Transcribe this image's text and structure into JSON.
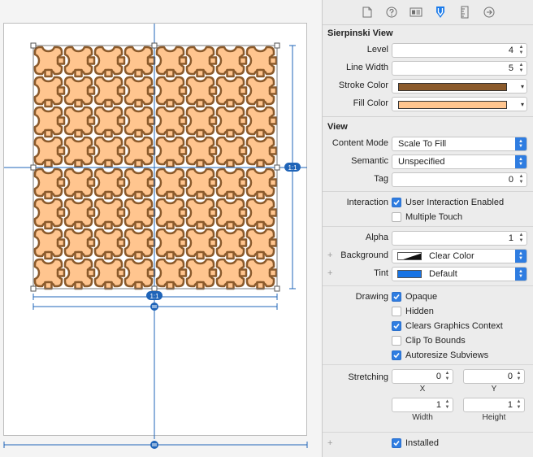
{
  "colors": {
    "fill": "#ffc58f",
    "stroke": "#8b5a2b",
    "accent": "#1b7bea",
    "guide": "#1f64b8",
    "tint": "#1874e5"
  },
  "canvas": {
    "ratio_label_vertical": "1:1",
    "ratio_label_horizontal": "1:1"
  },
  "inspector": {
    "tabs": [
      {
        "icon": "file-icon"
      },
      {
        "icon": "help-icon"
      },
      {
        "icon": "identity-icon"
      },
      {
        "icon": "attributes-icon"
      },
      {
        "icon": "size-icon"
      },
      {
        "icon": "connections-icon"
      }
    ],
    "sierpinski": {
      "title": "Sierpinski View",
      "level_label": "Level",
      "level_value": "4",
      "line_width_label": "Line Width",
      "line_width_value": "5",
      "stroke_color_label": "Stroke Color",
      "fill_color_label": "Fill Color"
    },
    "view": {
      "title": "View",
      "content_mode_label": "Content Mode",
      "content_mode_value": "Scale To Fill",
      "semantic_label": "Semantic",
      "semantic_value": "Unspecified",
      "tag_label": "Tag",
      "tag_value": "0",
      "interaction_label": "Interaction",
      "user_interaction_label": "User Interaction Enabled",
      "multiple_touch_label": "Multiple Touch",
      "alpha_label": "Alpha",
      "alpha_value": "1",
      "background_label": "Background",
      "background_value": "Clear Color",
      "tint_label": "Tint",
      "tint_value": "Default",
      "drawing_label": "Drawing",
      "opaque_label": "Opaque",
      "hidden_label": "Hidden",
      "clears_label": "Clears Graphics Context",
      "clip_label": "Clip To Bounds",
      "autoresize_label": "Autoresize Subviews",
      "stretching_label": "Stretching",
      "stretch_x_value": "0",
      "stretch_y_value": "0",
      "stretch_width_value": "1",
      "stretch_height_value": "1",
      "x_label": "X",
      "y_label": "Y",
      "width_label": "Width",
      "height_label": "Height",
      "installed_label": "Installed"
    }
  }
}
